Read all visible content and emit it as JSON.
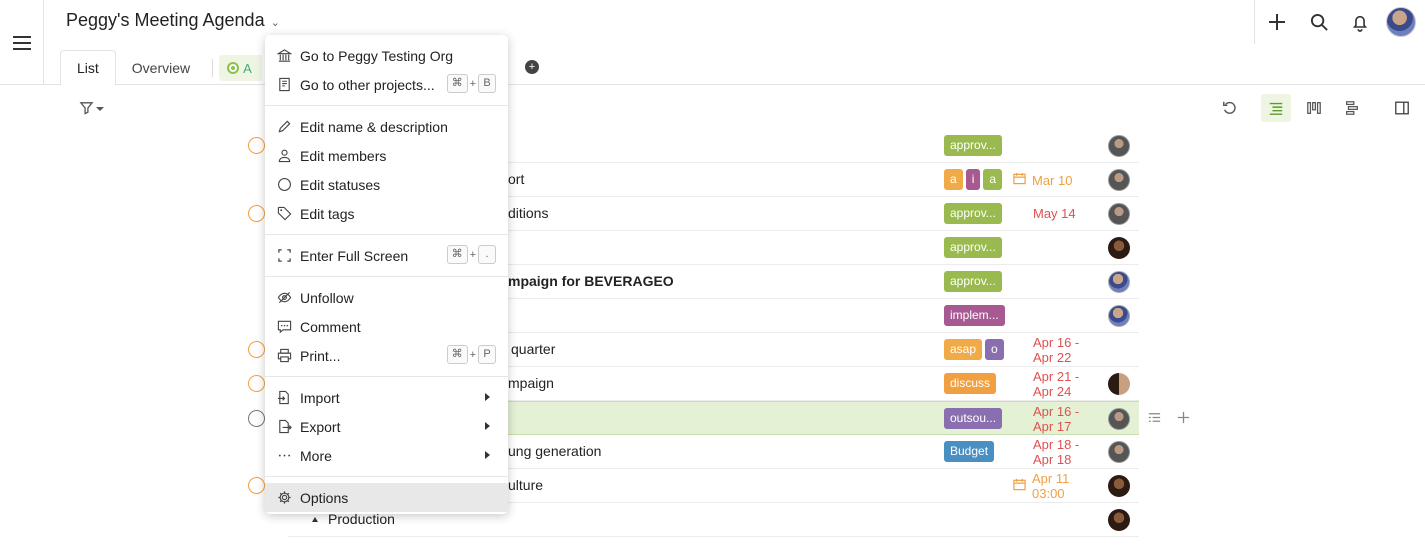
{
  "header": {
    "project_title": "Peggy's Meeting Agenda",
    "tabs": [
      {
        "label": "List",
        "active": true
      },
      {
        "label": "Overview",
        "active": false
      },
      {
        "label": "A",
        "active": false
      }
    ]
  },
  "colors": {
    "approved": "#9ab94f",
    "implement": "#a65a91",
    "asap": "#f0aa48",
    "o_tag": "#8a6fb0",
    "discuss": "#f0a040",
    "outsource": "#8a6fb0",
    "budget": "#4a8fc1",
    "tag_a": "#f0aa48",
    "tag_i": "#a65a91",
    "tag_a2": "#9ab94f",
    "date_red": "#e05050",
    "date_orange": "#f0a040",
    "highlight": "#e4f1d4"
  },
  "menu": {
    "items": [
      {
        "label": "Go to Peggy Testing Org",
        "icon": "bank-icon"
      },
      {
        "label": "Go to other projects...",
        "icon": "document-icon",
        "shortcut": [
          "⌘",
          "+",
          "B"
        ]
      },
      {
        "separator": true
      },
      {
        "label": "Edit name & description",
        "icon": "pencil-icon"
      },
      {
        "label": "Edit members",
        "icon": "person-icon"
      },
      {
        "label": "Edit statuses",
        "icon": "circle-icon"
      },
      {
        "label": "Edit tags",
        "icon": "tag-icon"
      },
      {
        "separator": true
      },
      {
        "label": "Enter Full Screen",
        "icon": "fullscreen-icon",
        "shortcut": [
          "⌘",
          "+",
          "."
        ]
      },
      {
        "separator": true
      },
      {
        "label": "Unfollow",
        "icon": "eye-slash-icon"
      },
      {
        "label": "Comment",
        "icon": "comment-icon"
      },
      {
        "label": "Print...",
        "icon": "printer-icon",
        "shortcut": [
          "⌘",
          "+",
          "P"
        ]
      },
      {
        "separator": true
      },
      {
        "label": "Import",
        "icon": "import-icon",
        "submenu": true
      },
      {
        "label": "Export",
        "icon": "export-icon",
        "submenu": true
      },
      {
        "label": "More",
        "icon": "ellipsis-icon",
        "submenu": true
      },
      {
        "separator": true
      },
      {
        "label": "Options",
        "icon": "gear-icon",
        "selected": true
      }
    ]
  },
  "rows": [
    {
      "title": "",
      "status": "orange",
      "tags": [
        {
          "label": "approv...",
          "color": "approved"
        }
      ],
      "date": "",
      "avatar": "a"
    },
    {
      "title": "ort",
      "status": "none",
      "tags": [
        {
          "label": "a",
          "color": "tag_a"
        },
        {
          "label": "i",
          "color": "tag_i"
        },
        {
          "label": "a",
          "color": "tag_a2"
        }
      ],
      "date": "Mar 10",
      "date_style": "orange-cal",
      "avatar": "a"
    },
    {
      "title": "ditions",
      "status": "orange",
      "tags": [
        {
          "label": "approv...",
          "color": "approved"
        }
      ],
      "date": "May 14",
      "date_style": "red",
      "avatar": "a"
    },
    {
      "title": "",
      "status": "none",
      "tags": [
        {
          "label": "approv...",
          "color": "approved"
        }
      ],
      "date": "",
      "avatar": "b"
    },
    {
      "title": "mpaign for BEVERAGEO",
      "bold": true,
      "status": "none",
      "tags": [
        {
          "label": "approv...",
          "color": "approved"
        }
      ],
      "date": "",
      "avatar": "c"
    },
    {
      "title": "",
      "status": "none",
      "tags": [
        {
          "label": "implem...",
          "color": "implement"
        }
      ],
      "date": "",
      "avatar": "c"
    },
    {
      "title": "quarter",
      "status": "orange",
      "tags": [
        {
          "label": "asap",
          "color": "asap"
        },
        {
          "label": "o",
          "color": "o_tag"
        }
      ],
      "date": "Apr 16 -",
      "date2": "Apr 22",
      "date_style": "red",
      "avatar": ""
    },
    {
      "title": "mpaign",
      "status": "orange",
      "tags": [
        {
          "label": "discuss",
          "color": "discuss"
        }
      ],
      "date": "Apr 21 -",
      "date2": "Apr 24",
      "date_style": "red",
      "avatar": "d"
    },
    {
      "title": "",
      "status": "empty",
      "highlight": true,
      "tags": [
        {
          "label": "outsou...",
          "color": "outsource"
        }
      ],
      "date": "Apr 16 -",
      "date2": "Apr 17",
      "date_style": "red",
      "avatar": "a"
    },
    {
      "title": "ung generation",
      "status": "none",
      "tags": [
        {
          "label": "Budget",
          "color": "budget"
        }
      ],
      "date": "Apr 18 -",
      "date2": "Apr 18",
      "date_style": "red",
      "avatar": "a"
    },
    {
      "title": "ulture",
      "status": "orange",
      "tags": [],
      "date": "Apr 11",
      "date2": "03:00",
      "date_style": "orange-cal",
      "avatar": "b"
    },
    {
      "title": "Production",
      "status": "none",
      "tags": [],
      "date": "",
      "avatar": "b",
      "group": true
    }
  ]
}
